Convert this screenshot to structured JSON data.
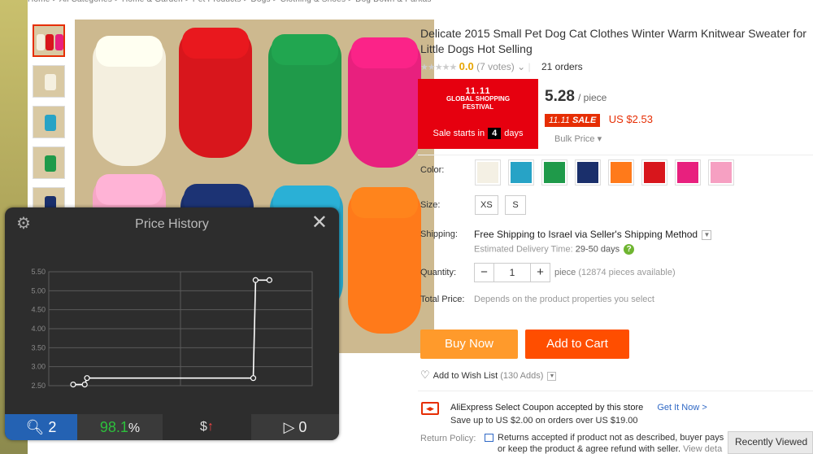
{
  "breadcrumb": [
    "Home",
    "All Categories",
    "Home & Garden",
    "Pet Products",
    "Dogs",
    "Clothing & Shoes",
    "Dog Down & Parkas"
  ],
  "product": {
    "title": "Delicate 2015 Small Pet Dog Cat Clothes Winter Warm Knitwear Sweater for Little Dogs Hot Selling",
    "rating_score": "0.0",
    "votes": "(7 votes)",
    "orders": "21 orders",
    "price": "5.28",
    "price_unit": "/ piece",
    "sale_tag_num": "11.11",
    "sale_tag_label": "SALE",
    "sale_price": "US $2.53",
    "bulk_price": "Bulk Price ▾"
  },
  "festival": {
    "logo_top": "11.11",
    "logo_line1": "GLOBAL SHOPPING",
    "logo_line2": "FESTIVAL",
    "sale_prefix": "Sale starts in",
    "days_number": "4",
    "days_label": "days"
  },
  "options": {
    "color_label": "Color:",
    "colors": [
      "#f4f0e4",
      "#27a3c6",
      "#1f9a4a",
      "#1a2f6b",
      "#ff7a1a",
      "#d8161c",
      "#e8207e",
      "#f6a0c2"
    ],
    "size_label": "Size:",
    "sizes": [
      "XS",
      "S"
    ],
    "shipping_label": "Shipping:",
    "shipping_text": "Free Shipping to Israel via Seller's Shipping Method",
    "delivery_prefix": "Estimated Delivery Time:",
    "delivery_days": "29-50 days",
    "quantity_label": "Quantity:",
    "quantity_value": "1",
    "piece_label": "piece",
    "available": "(12874 pieces available)",
    "total_label": "Total Price:",
    "total_text": "Depends on the product properties you select"
  },
  "actions": {
    "buy_now": "Buy Now",
    "add_to_cart": "Add to Cart",
    "wishlist": "Add to Wish List",
    "wishlist_count": "(130 Adds)"
  },
  "coupon": {
    "title": "AliExpress Select Coupon accepted by this store",
    "link": "Get It Now >",
    "sub": "Save up to US $2.00 on orders over US $19.00"
  },
  "returns": {
    "label": "Return Policy:",
    "line1": "Returns accepted if product not as described, buyer pays",
    "line2": "or keep the product & agree refund with seller.",
    "view": "View deta"
  },
  "recently_viewed": "Recently Viewed",
  "price_history": {
    "title": "Price History",
    "searches": "2",
    "score": "98.1",
    "score_unit": "%",
    "trend_symbol": "$",
    "trend_arrow": "↑",
    "views": "0"
  },
  "chart_data": {
    "type": "line",
    "title": "Price History",
    "yticks": [
      "5.50",
      "5.00",
      "4.50",
      "4.00",
      "3.50",
      "3.00",
      "2.50"
    ],
    "ylim": [
      2.5,
      5.5
    ],
    "series": [
      {
        "points": [
          {
            "x": 0.0,
            "y": 2.53
          },
          {
            "x": 0.05,
            "y": 2.53
          },
          {
            "x": 0.06,
            "y": 2.7
          },
          {
            "x": 0.78,
            "y": 2.7
          },
          {
            "x": 0.79,
            "y": 5.28
          },
          {
            "x": 0.85,
            "y": 5.28
          }
        ]
      }
    ],
    "grid": true,
    "colors": {
      "line": "#ffffff",
      "grid": "#5a5a5a",
      "tick": "#8a8a8a"
    }
  }
}
